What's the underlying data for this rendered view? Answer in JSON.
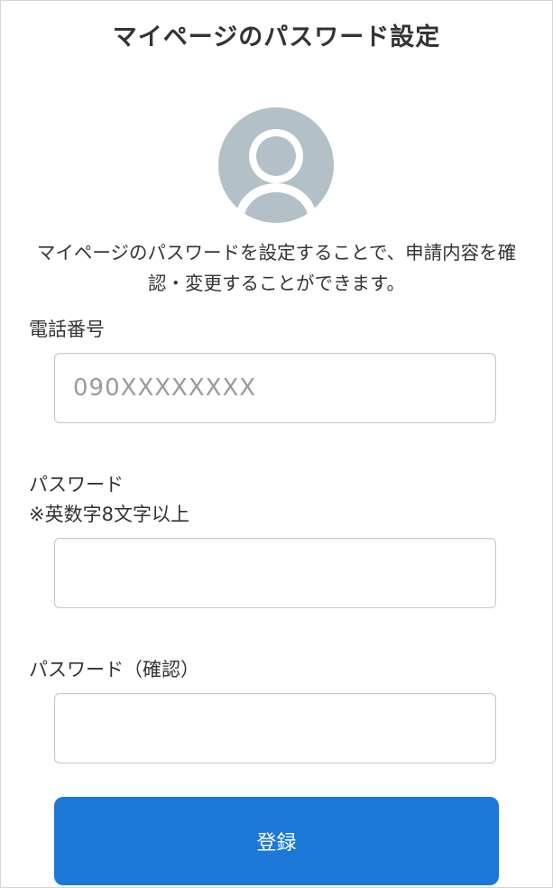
{
  "header": {
    "title": "マイページのパスワード設定"
  },
  "profile": {
    "avatar_icon": "user-avatar-icon",
    "avatar_color": "#b3c0c7"
  },
  "description": {
    "line1": "マイページのパスワードを設定することで、申請内容を確",
    "line2": "認・変更することができます。"
  },
  "form": {
    "phone": {
      "label": "電話番号",
      "placeholder": "090XXXXXXXX",
      "value": ""
    },
    "password": {
      "label": "パスワード",
      "note": "※英数字8文字以上",
      "value": ""
    },
    "password_confirm": {
      "label": "パスワード（確認）",
      "value": ""
    },
    "submit_label": "登録",
    "submit_color": "#1b78d6"
  }
}
